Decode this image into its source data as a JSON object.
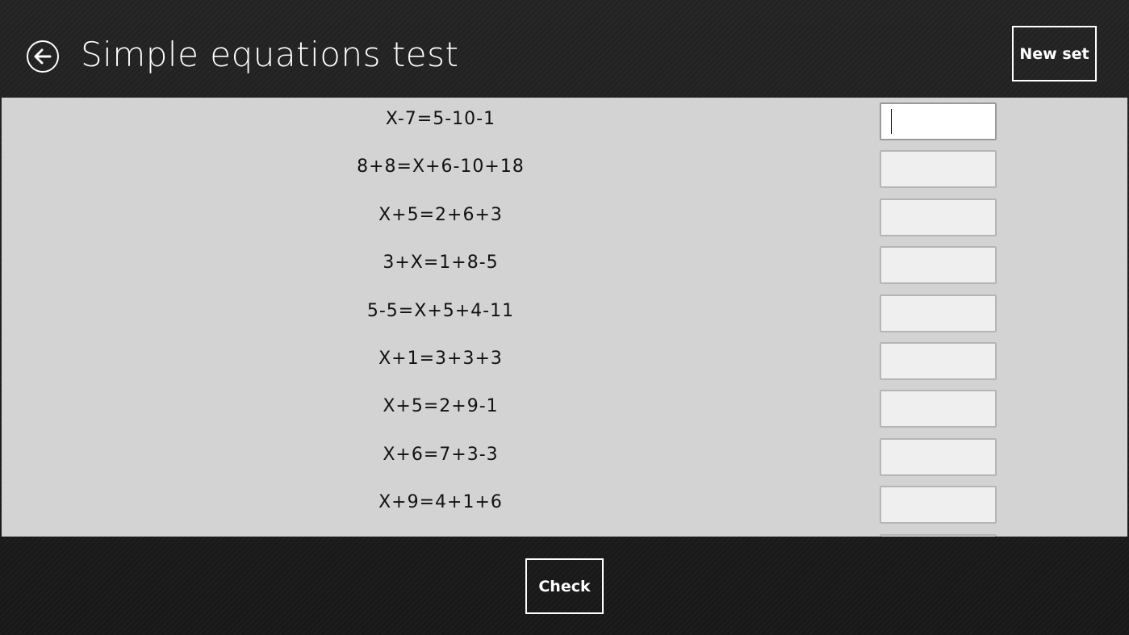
{
  "header": {
    "title": "Simple equations test",
    "new_set_label": "New set",
    "back_icon": "arrow-left-icon"
  },
  "equations": [
    {
      "text": "X-7=5-10-1",
      "answer": ""
    },
    {
      "text": "8+8=X+6-10+18",
      "answer": ""
    },
    {
      "text": "X+5=2+6+3",
      "answer": ""
    },
    {
      "text": "3+X=1+8-5",
      "answer": ""
    },
    {
      "text": "5-5=X+5+4-11",
      "answer": ""
    },
    {
      "text": "X+1=3+3+3",
      "answer": ""
    },
    {
      "text": "X+5=2+9-1",
      "answer": ""
    },
    {
      "text": "X+6=7+3-3",
      "answer": ""
    },
    {
      "text": "X+9=4+1+6",
      "answer": ""
    },
    {
      "text": "",
      "answer": ""
    }
  ],
  "footer": {
    "check_label": "Check"
  },
  "colors": {
    "background": "#1b1b1b",
    "content_bg": "#d3d3d3",
    "input_bg": "#efefef",
    "input_focused_bg": "#ffffff",
    "text_light": "#ffffff",
    "text_dark": "#111111"
  }
}
